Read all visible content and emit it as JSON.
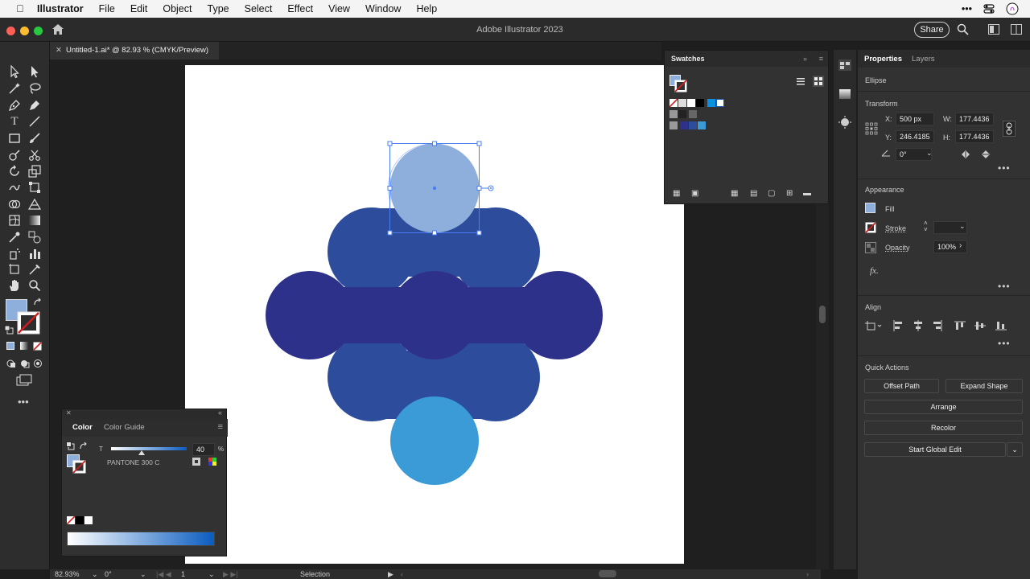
{
  "menubar": {
    "app_name": "Illustrator",
    "items": [
      "File",
      "Edit",
      "Object",
      "Type",
      "Select",
      "Effect",
      "View",
      "Window",
      "Help"
    ]
  },
  "titlebar": {
    "title": "Adobe Illustrator 2023",
    "share_label": "Share"
  },
  "document": {
    "tab_title": "Untitled-1.ai* @ 82.93 % (CMYK/Preview)"
  },
  "swatches": {
    "title": "Swatches"
  },
  "properties": {
    "tabs": [
      "Properties",
      "Layers"
    ],
    "selection_type": "Ellipse",
    "transform": {
      "title": "Transform",
      "x_label": "X:",
      "x_value": "500 px",
      "y_label": "Y:",
      "y_value": "246.4185",
      "w_label": "W:",
      "w_value": "177.4436",
      "h_label": "H:",
      "h_value": "177.4436",
      "angle_value": "0°"
    },
    "appearance": {
      "title": "Appearance",
      "fill_label": "Fill",
      "stroke_label": "Stroke",
      "opacity_label": "Opacity",
      "opacity_value": "100%",
      "fx_label": "fx."
    },
    "align": {
      "title": "Align"
    },
    "quick_actions": {
      "title": "Quick Actions",
      "offset_path": "Offset Path",
      "expand_shape": "Expand Shape",
      "arrange": "Arrange",
      "recolor": "Recolor",
      "start_global_edit": "Start Global Edit"
    }
  },
  "color_panel": {
    "tabs": [
      "Color",
      "Color Guide"
    ],
    "tint_label": "T",
    "tint_value": "40",
    "percent": "%",
    "swatch_name": "PANTONE 300 C"
  },
  "statusbar": {
    "zoom": "82.93%",
    "angle": "0°",
    "artboard": "1",
    "tool": "Selection"
  },
  "colors": {
    "selected_fill": "#8eafdc",
    "row1": "#2d4d9c",
    "row2": "#2e3189",
    "bottom_circle": "#3a9bd7",
    "selection": "#4a7cf2"
  },
  "icons": [
    "apple-icon",
    "home-icon",
    "search-icon",
    "selection-tool-icon",
    "direct-selection-tool-icon",
    "pen-tool-icon",
    "type-tool-icon",
    "rectangle-tool-icon",
    "hand-tool-icon",
    "zoom-tool-icon",
    "link-icon"
  ]
}
